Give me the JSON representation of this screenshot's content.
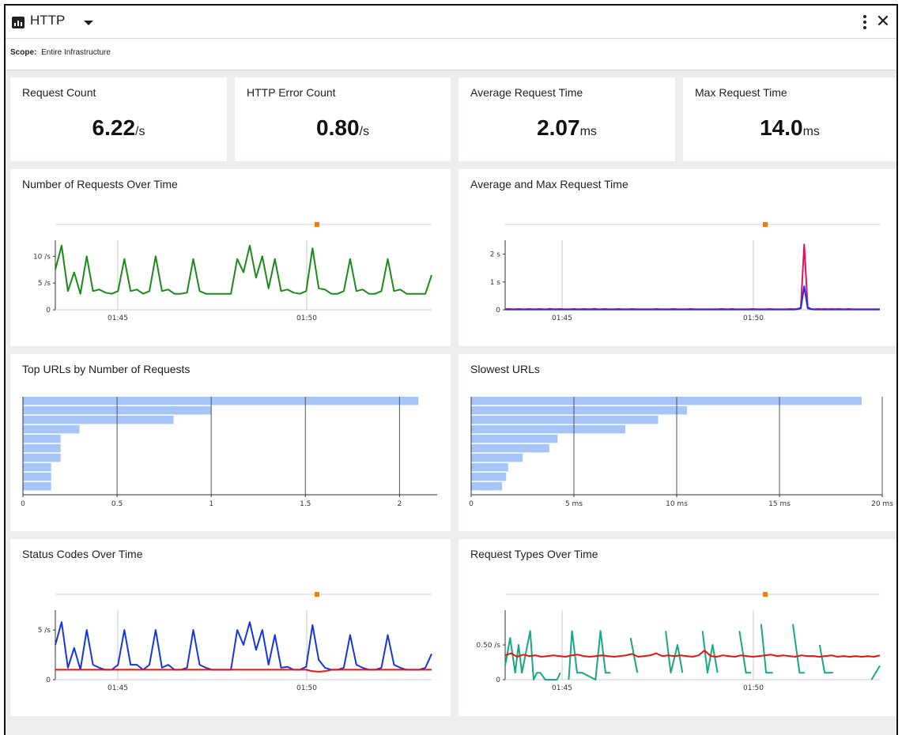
{
  "header": {
    "title": "HTTP",
    "scope_label": "Scope:",
    "scope_value": "Entire Infrastructure",
    "icons": [
      "bar-chart-icon",
      "chevron-down-icon",
      "more-vert-icon",
      "close-icon"
    ]
  },
  "kpis": [
    {
      "label": "Request Count",
      "value": "6.22",
      "unit": "/s"
    },
    {
      "label": "HTTP Error Count",
      "value": "0.80",
      "unit": "/s"
    },
    {
      "label": "Average Request Time",
      "value": "2.07",
      "unit": "ms"
    },
    {
      "label": "Max Request Time",
      "value": "14.0",
      "unit": "ms"
    }
  ],
  "colors": {
    "green": "#1a8a1a",
    "pink": "#e0115f",
    "blue": "#1536e0",
    "red": "#e8130e",
    "teal": "#17a883",
    "bar": "#a6c4f5",
    "marker": "#f57c00"
  },
  "panels": {
    "requests_over_time": "Number of Requests Over Time",
    "avg_max_time": "Average and Max Request Time",
    "top_urls": "Top URLs by Number of Requests",
    "slowest_urls": "Slowest URLs",
    "status_codes": "Status Codes Over Time",
    "request_types": "Request Types Over Time"
  },
  "chart_data": [
    {
      "id": "requests",
      "type": "line",
      "title": "Number of Requests Over Time",
      "x_ticks": [
        "01:45",
        "01:50"
      ],
      "y_ticks": [
        "0",
        "5 /s",
        "10 /s"
      ],
      "ylim": [
        0,
        13
      ],
      "series": [
        {
          "color": "green",
          "values": [
            7.5,
            12,
            3.5,
            7,
            3,
            10,
            3.5,
            3.8,
            3.2,
            3,
            3.5,
            9.5,
            3.5,
            3.8,
            3,
            3.5,
            10,
            3.5,
            3.8,
            3,
            3,
            3.2,
            9.5,
            3.5,
            3,
            3,
            3,
            3,
            3,
            9.5,
            7,
            12,
            6,
            10,
            4,
            9.5,
            3.5,
            3.8,
            3.2,
            3,
            3.5,
            11.5,
            4,
            3.8,
            3,
            3,
            3.5,
            9.5,
            3.5,
            3.8,
            3,
            3,
            3.5,
            9.5,
            3.5,
            3.8,
            3,
            3,
            3,
            3,
            6.5
          ]
        }
      ]
    },
    {
      "id": "reqtime",
      "type": "line",
      "title": "Average and Max Request Time",
      "x_ticks": [
        "01:45",
        "01:50"
      ],
      "y_ticks": [
        "0",
        "1 s",
        "2 s"
      ],
      "ylim": [
        0,
        2.5
      ],
      "series": [
        {
          "color": "pink",
          "values": [
            0.02,
            0.03,
            0.02,
            0.02,
            0.03,
            0.02,
            0.02,
            0.03,
            0.02,
            0.02,
            0.03,
            0.02,
            0.02,
            0.04,
            0.02,
            0.02,
            0.03,
            0.02,
            0.02,
            0.02,
            0.03,
            0.02,
            0.02,
            0.03,
            0.02,
            0.02,
            0.04,
            0.02,
            0.02,
            0.03,
            0.02,
            0.02,
            0.02,
            0.03,
            0.02,
            0.02,
            0.02,
            0.03,
            0.02,
            0.02,
            0.02,
            0.02,
            0.02,
            0.02,
            0.03,
            0.02,
            0.02,
            0.02,
            0.02,
            0.03,
            0.02,
            0.02,
            0.02,
            0.02,
            0.03,
            0.02,
            0.02,
            0.02,
            0.02,
            0.02,
            0.02,
            0.02,
            0.02,
            0.03,
            0.02,
            0.02,
            0.03,
            0.02,
            0.02,
            0.02,
            0.02,
            0.02,
            0.03,
            0.02,
            0.02,
            0.02,
            0.02,
            0.03,
            0.02,
            0.02,
            0.02,
            0.02,
            0.02,
            0.03,
            0.02,
            0.03,
            0.08,
            2.35,
            0.1,
            0.03,
            0.02,
            0.03,
            0.02,
            0.03,
            0.02,
            0.03,
            0.02,
            0.03,
            0.02,
            0.02,
            0.03,
            0.02,
            0.02,
            0.02,
            0.02,
            0.02,
            0.02,
            0.02,
            0.02,
            0.02
          ]
        },
        {
          "color": "blue",
          "values": [
            0.01,
            0.01,
            0.01,
            0.01,
            0.01,
            0.01,
            0.01,
            0.01,
            0.01,
            0.01,
            0.01,
            0.01,
            0.01,
            0.01,
            0.01,
            0.01,
            0.01,
            0.01,
            0.01,
            0.01,
            0.01,
            0.01,
            0.01,
            0.01,
            0.01,
            0.01,
            0.01,
            0.01,
            0.01,
            0.01,
            0.01,
            0.01,
            0.01,
            0.01,
            0.01,
            0.01,
            0.01,
            0.01,
            0.01,
            0.01,
            0.01,
            0.01,
            0.01,
            0.01,
            0.01,
            0.01,
            0.01,
            0.01,
            0.01,
            0.01,
            0.01,
            0.01,
            0.01,
            0.01,
            0.01,
            0.01,
            0.01,
            0.01,
            0.01,
            0.01,
            0.01,
            0.01,
            0.01,
            0.01,
            0.01,
            0.01,
            0.01,
            0.01,
            0.01,
            0.01,
            0.01,
            0.01,
            0.01,
            0.01,
            0.01,
            0.01,
            0.01,
            0.01,
            0.01,
            0.01,
            0.01,
            0.01,
            0.01,
            0.01,
            0.01,
            0.02,
            0.05,
            0.85,
            0.05,
            0.02,
            0.01,
            0.01,
            0.01,
            0.01,
            0.01,
            0.01,
            0.01,
            0.01,
            0.01,
            0.01,
            0.01,
            0.01,
            0.01,
            0.01,
            0.01,
            0.01,
            0.01,
            0.01,
            0.01,
            0.01
          ]
        }
      ]
    },
    {
      "id": "topurls",
      "type": "bar",
      "orientation": "horizontal",
      "title": "Top URLs by Number of Requests",
      "x_ticks": [
        "0",
        "0.5",
        "1",
        "1.5",
        "2"
      ],
      "xlim": [
        0,
        2.2
      ],
      "values": [
        2.1,
        1.0,
        0.8,
        0.3,
        0.2,
        0.2,
        0.2,
        0.15,
        0.15,
        0.15
      ]
    },
    {
      "id": "slowest",
      "type": "bar",
      "orientation": "horizontal",
      "title": "Slowest URLs",
      "x_ticks": [
        "0",
        "5 ms",
        "10 ms",
        "15 ms",
        "20 ms"
      ],
      "xlim": [
        0,
        20
      ],
      "values": [
        19,
        10.5,
        9.1,
        7.5,
        4.2,
        3.8,
        2.5,
        1.8,
        1.7,
        1.5
      ]
    },
    {
      "id": "status",
      "type": "line",
      "title": "Status Codes Over Time",
      "x_ticks": [
        "01:45",
        "01:50"
      ],
      "y_ticks": [
        "0",
        "5 /s"
      ],
      "ylim": [
        0,
        7
      ],
      "series": [
        {
          "color": "blue",
          "values": [
            3.5,
            5.8,
            1.2,
            3.2,
            1,
            5,
            1.5,
            1.2,
            1,
            1,
            1.5,
            5,
            1.5,
            1.5,
            1,
            1.5,
            5,
            1.2,
            1.5,
            1,
            1,
            1.2,
            5,
            1.5,
            1.2,
            1,
            1,
            1,
            1,
            5,
            3.5,
            5.8,
            3,
            5,
            1.5,
            4.5,
            1.2,
            1.3,
            1,
            1,
            1.3,
            5.5,
            2,
            1.2,
            1,
            1,
            1.2,
            4.5,
            1.5,
            1.2,
            1,
            1,
            1.2,
            4.5,
            1.5,
            1.2,
            1,
            1,
            1,
            1.2,
            2.6
          ]
        },
        {
          "color": "red",
          "values": [
            1,
            1,
            1,
            1,
            1,
            1,
            1,
            1,
            1,
            1,
            1,
            1,
            1,
            1,
            1,
            1,
            1,
            1,
            1,
            1,
            1,
            1,
            1,
            1,
            1,
            1,
            1,
            1,
            1,
            1,
            1,
            1,
            1,
            1,
            1,
            1,
            1,
            1,
            1,
            1,
            1,
            0.85,
            0.8,
            0.85,
            1,
            1,
            1,
            1,
            1,
            1,
            1,
            1,
            1,
            1,
            1,
            1,
            1,
            1,
            1,
            1,
            1
          ]
        }
      ]
    },
    {
      "id": "types",
      "type": "line",
      "title": "Request Types Over Time",
      "x_ticks": [
        "01:45",
        "01:50"
      ],
      "y_ticks": [
        "0",
        "0.50 /s"
      ],
      "ylim": [
        0,
        1
      ],
      "series": [
        {
          "color": "teal",
          "segments": [
            [
              [
                0,
                0.2
              ],
              [
                3,
                0.6
              ],
              [
                6,
                0.1
              ],
              [
                8,
                0.5
              ],
              [
                10,
                0.1
              ],
              [
                15,
                0.7
              ],
              [
                17,
                0
              ],
              [
                19,
                0.1
              ],
              [
                21,
                0.1
              ],
              [
                24,
                0
              ],
              [
                28,
                0
              ],
              [
                31,
                0
              ],
              [
                33,
                0.1
              ]
            ],
            [
              [
                38,
                0
              ],
              [
                40,
                0.7
              ],
              [
                43,
                0.1
              ],
              [
                46,
                0.1
              ],
              [
                54,
                0
              ],
              [
                57,
                0.7
              ],
              [
                60,
                0.1
              ],
              [
                63,
                0.1
              ]
            ],
            [
              [
                75,
                0.6
              ],
              [
                79,
                0.1
              ]
            ],
            [
              [
                96,
                0.7
              ],
              [
                99,
                0.1
              ],
              [
                103,
                0.5
              ],
              [
                106,
                0.1
              ]
            ],
            [
              [
                118,
                0.7
              ],
              [
                121,
                0.1
              ],
              [
                124,
                0.5
              ],
              [
                127,
                0.1
              ]
            ],
            [
              [
                140,
                0.7
              ],
              [
                144,
                0.1
              ],
              [
                147,
                0.1
              ]
            ],
            [
              [
                153,
                0.8
              ],
              [
                156,
                0.1
              ],
              [
                160,
                0.1
              ]
            ],
            [
              [
                172,
                0.8
              ],
              [
                176,
                0.1
              ],
              [
                179,
                0.1
              ]
            ],
            [
              [
                188,
                0.5
              ],
              [
                191,
                0.1
              ],
              [
                196,
                0.1
              ]
            ],
            [
              [
                219,
                0
              ],
              [
                224,
                0.2
              ]
            ]
          ],
          "xmax": 224
        },
        {
          "color": "red",
          "values": [
            0.35,
            0.38,
            0.33,
            0.36,
            0.34,
            0.35,
            0.33,
            0.34,
            0.35,
            0.34,
            0.33,
            0.35,
            0.36,
            0.34,
            0.33,
            0.34,
            0.35,
            0.34,
            0.33,
            0.34,
            0.35,
            0.37,
            0.33,
            0.34,
            0.35,
            0.38,
            0.34,
            0.35,
            0.34,
            0.35,
            0.34,
            0.33,
            0.35,
            0.42,
            0.34,
            0.33,
            0.35,
            0.34,
            0.33,
            0.35,
            0.34,
            0.33,
            0.34,
            0.35,
            0.36,
            0.34,
            0.35,
            0.34,
            0.33,
            0.35,
            0.34,
            0.34,
            0.33,
            0.34,
            0.35,
            0.33,
            0.34,
            0.33,
            0.34,
            0.33,
            0.34,
            0.33,
            0.35
          ]
        }
      ]
    }
  ]
}
